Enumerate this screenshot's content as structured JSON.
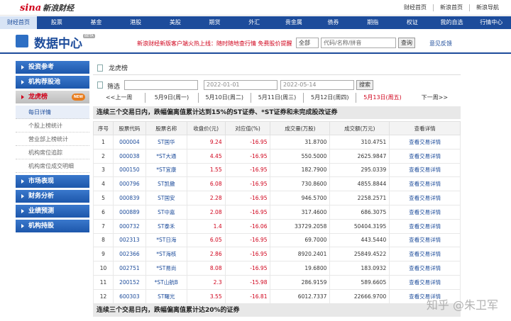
{
  "topbar": {
    "logo_sina": "sina",
    "logo_fin": "新浪财经",
    "links": [
      "财经首页",
      "新浪首页",
      "新浪导航"
    ]
  },
  "nav": [
    "财经首页",
    "股票",
    "基金",
    "港股",
    "美股",
    "期货",
    "外汇",
    "贵金属",
    "债券",
    "期指",
    "权证",
    "我的自选",
    "行情中心"
  ],
  "header": {
    "title": "数据中心",
    "beta": "BETA",
    "promo": "新浪财经新版客户端火热上线：随时随地查行情 免费股价提醒",
    "select": "全部",
    "search_placeholder": "代码/名称/拼音",
    "search_button": "查询",
    "feedback": "意见反馈"
  },
  "sidebar": [
    {
      "label": "投资参考",
      "active": false,
      "subs": []
    },
    {
      "label": "机构荐股池",
      "active": false,
      "subs": []
    },
    {
      "label": "龙虎榜",
      "active": true,
      "badge": "NEW",
      "subs": [
        "每日详情",
        "个股上榜统计",
        "营业部上榜统计",
        "机构席位追踪",
        "机构席位成交明细"
      ]
    },
    {
      "label": "市场表现",
      "active": false,
      "subs": []
    },
    {
      "label": "财务分析",
      "active": false,
      "subs": []
    },
    {
      "label": "业绩预测",
      "active": false,
      "subs": []
    },
    {
      "label": "机构持股",
      "active": false,
      "subs": []
    }
  ],
  "main": {
    "breadcrumb": "龙虎榜",
    "filter_label": "筛选",
    "date_start": "2022-01-01",
    "date_end": "2022-05-14",
    "search_button": "搜索",
    "days": [
      "<<上一周",
      "5月9日(周一)",
      "5月10日(周二)",
      "5月11日(周三)",
      "5月12日(周四)",
      "5月13日(周五)",
      "下一周>>"
    ],
    "current_day_index": 5,
    "caption1": "连续三个交易日内，跌幅偏离值累计达到15%的ST证券、*ST证券和未完成股改证券",
    "caption2": "连续三个交易日内，跌幅偏离值累计达20%的证券",
    "columns": [
      "序号",
      "股票代码",
      "股票名称",
      "收盘价(元)",
      "对应值(%)",
      "成交量(万股)",
      "成交额(万元)",
      "查看详情"
    ],
    "rows": [
      [
        "1",
        "000004",
        "ST国华",
        "9.24",
        "-16.95",
        "31.8700",
        "310.4751",
        "查看交易详情"
      ],
      [
        "2",
        "000038",
        "*ST大通",
        "4.45",
        "-16.95",
        "550.5000",
        "2625.9847",
        "查看交易详情"
      ],
      [
        "3",
        "000150",
        "*ST宜康",
        "1.55",
        "-16.95",
        "182.7900",
        "295.0339",
        "查看交易详情"
      ],
      [
        "4",
        "000796",
        "ST凯撒",
        "6.08",
        "-16.95",
        "730.8600",
        "4855.8844",
        "查看交易详情"
      ],
      [
        "5",
        "000839",
        "ST国安",
        "2.28",
        "-16.95",
        "946.5700",
        "2258.2571",
        "查看交易详情"
      ],
      [
        "6",
        "000889",
        "ST中嘉",
        "2.08",
        "-16.95",
        "317.4600",
        "686.3075",
        "查看交易详情"
      ],
      [
        "7",
        "000732",
        "ST泰禾",
        "1.4",
        "-16.06",
        "33729.2058",
        "50404.3195",
        "查看交易详情"
      ],
      [
        "8",
        "002313",
        "*ST日海",
        "6.05",
        "-16.95",
        "69.7000",
        "443.5440",
        "查看交易详情"
      ],
      [
        "9",
        "002366",
        "*ST海核",
        "2.86",
        "-16.95",
        "8920.2401",
        "25849.4522",
        "查看交易详情"
      ],
      [
        "10",
        "002751",
        "*ST易尚",
        "8.08",
        "-16.95",
        "19.6800",
        "183.0932",
        "查看交易详情"
      ],
      [
        "11",
        "200152",
        "*ST山航B",
        "2.3",
        "-15.98",
        "286.9159",
        "589.6605",
        "查看交易详情"
      ],
      [
        "12",
        "600303",
        "ST曙光",
        "3.55",
        "-16.81",
        "6012.7337",
        "22666.9700",
        "查看交易详情"
      ]
    ]
  },
  "watermark": "知乎 @朱卫军"
}
